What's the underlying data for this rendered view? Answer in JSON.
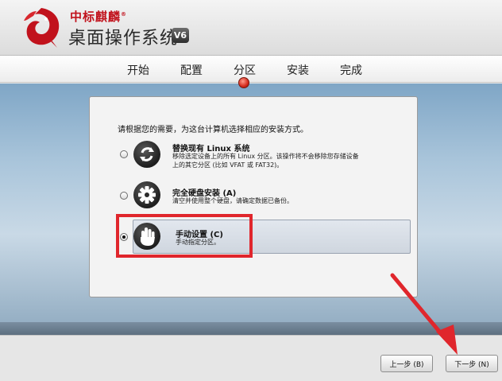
{
  "header": {
    "brand": "中标麒麟",
    "brand_mark": "®",
    "product": "桌面操作系统",
    "version": "V6"
  },
  "steps": [
    {
      "label": "开始"
    },
    {
      "label": "配置"
    },
    {
      "label": "分区",
      "current": true
    },
    {
      "label": "安装"
    },
    {
      "label": "完成"
    }
  ],
  "panel": {
    "prompt": "请根据您的需要，为这台计算机选择相应的安装方式。",
    "options": [
      {
        "title": "替换现有 Linux 系统",
        "desc_line1": "移除选定设备上的所有 Linux 分区。该操作将不会移除您存储设备",
        "desc_line2": "上的其它分区 (比如 VFAT 或 FAT32)。",
        "icon": "refresh-arrows-icon",
        "selected": false
      },
      {
        "title": "完全硬盘安装 (A)",
        "desc_line1": "清空并使用整个硬盘，请确定数据已备份。",
        "icon": "gear-icon",
        "selected": false
      },
      {
        "title": "手动设置 (C)",
        "desc_line1": "手动指定分区。",
        "icon": "hand-icon",
        "selected": true
      }
    ]
  },
  "buttons": {
    "back": "上一步 (B)",
    "next": "下一步 (N)"
  },
  "colors": {
    "annotation_red": "#e0262c",
    "brand_red": "#c1121c"
  }
}
